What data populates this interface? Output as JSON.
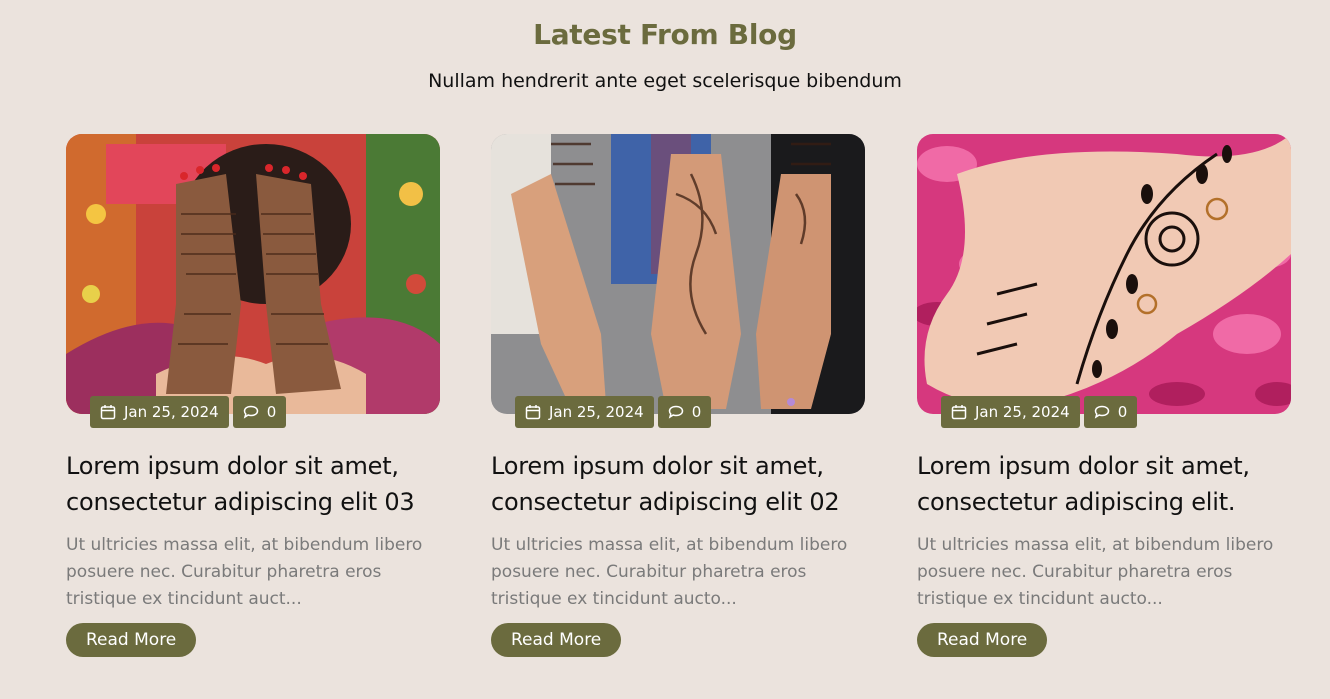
{
  "section": {
    "title": "Latest From Blog",
    "subtitle": "Nullam hendrerit ante eget scelerisque bibendum"
  },
  "posts": [
    {
      "image_icon": "henna-hands-photo",
      "date": "Jan 25, 2024",
      "comments": "0",
      "title": "Lorem ipsum dolor sit amet, consectetur adipiscing elit 03",
      "excerpt": "Ut ultricies massa elit, at bibendum libero posuere nec. Curabitur pharetra eros tristique ex tincidunt auct...",
      "read_more": "Read More"
    },
    {
      "image_icon": "henna-hands-photo",
      "date": "Jan 25, 2024",
      "comments": "0",
      "title": "Lorem ipsum dolor sit amet, consectetur adipiscing elit 02",
      "excerpt": "Ut ultricies massa elit, at bibendum libero posuere nec. Curabitur pharetra eros tristique ex tincidunt aucto...",
      "read_more": "Read More"
    },
    {
      "image_icon": "henna-hand-on-petals-photo",
      "date": "Jan 25, 2024",
      "comments": "0",
      "title": "Lorem ipsum dolor sit amet, consectetur adipiscing elit.",
      "excerpt": "Ut ultricies massa elit, at bibendum libero posuere nec. Curabitur pharetra eros tristique ex tincidunt aucto...",
      "read_more": "Read More"
    }
  ],
  "colors": {
    "background": "#ebe3dd",
    "accent": "#6b6b3e",
    "heading": "#6b6b3e",
    "excerpt_text": "#7a7a7a"
  }
}
